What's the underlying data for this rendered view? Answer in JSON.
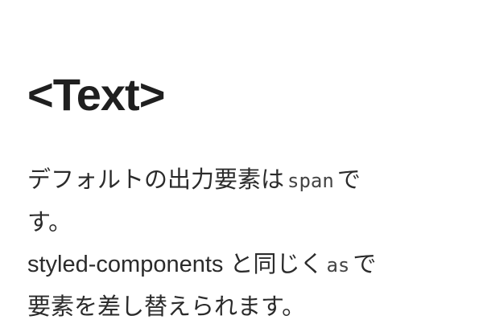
{
  "heading": "<Text>",
  "paragraph": {
    "line1_prefix": "デフォルトの出力要素は",
    "line1_code": "span",
    "line1_suffix": "で",
    "line2": "す。",
    "line3_prefix": "styled-components と同じく",
    "line3_code": "as",
    "line3_suffix": "で",
    "line4": "要素を差し替えられます。"
  }
}
